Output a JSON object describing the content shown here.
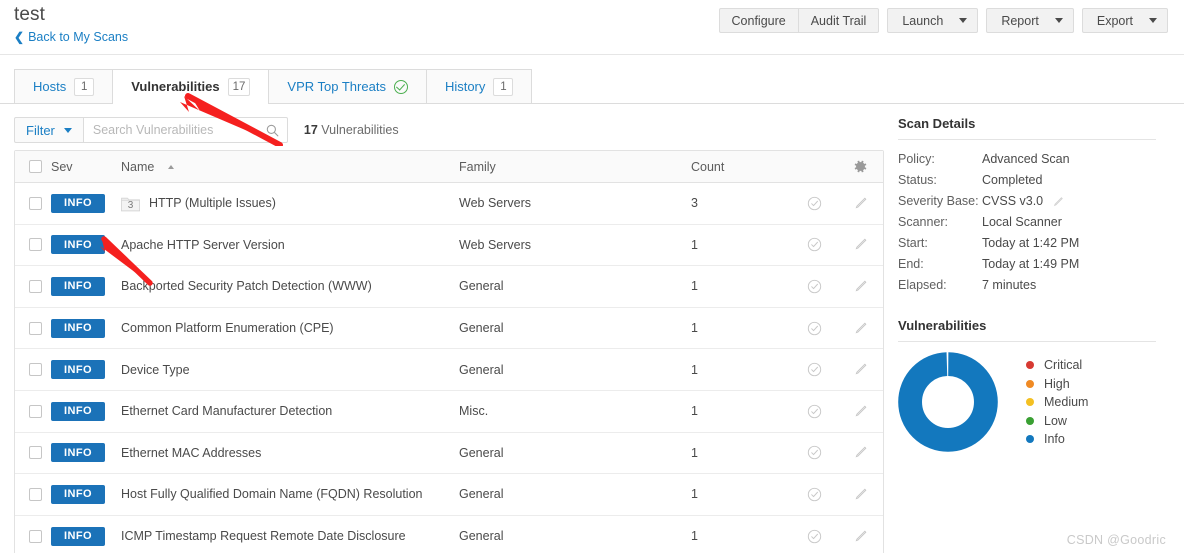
{
  "header": {
    "scan_title": "test",
    "back_link": "Back to My Scans",
    "back_icon": "chevron-left-icon",
    "actions": [
      {
        "label": "Configure",
        "type": "button"
      },
      {
        "label": "Audit Trail",
        "type": "button"
      },
      {
        "label": "Launch",
        "type": "split"
      },
      {
        "label": "Report",
        "type": "split"
      },
      {
        "label": "Export",
        "type": "split"
      }
    ]
  },
  "tabs": [
    {
      "label": "Hosts",
      "badge": "1",
      "active": false,
      "icon": ""
    },
    {
      "label": "Vulnerabilities",
      "badge": "17",
      "active": true,
      "icon": ""
    },
    {
      "label": "VPR Top Threats",
      "badge": "",
      "active": false,
      "icon": "check-circle-icon"
    },
    {
      "label": "History",
      "badge": "1",
      "active": false,
      "icon": ""
    }
  ],
  "toolbar": {
    "filter_label": "Filter",
    "search_placeholder": "Search Vulnerabilities",
    "search_value": "",
    "search_icon": "search-icon",
    "count_number": "17",
    "count_label": "Vulnerabilities"
  },
  "table": {
    "columns": {
      "sev": "Sev",
      "name": "Name",
      "family": "Family",
      "count": "Count",
      "settings_icon": "gear-icon"
    },
    "sort": {
      "column": "Name",
      "direction": "asc"
    },
    "rows": [
      {
        "severity": "INFO",
        "group_count": "3",
        "name": "HTTP (Multiple Issues)",
        "family": "Web Servers",
        "count": "3"
      },
      {
        "severity": "INFO",
        "group_count": "",
        "name": "Apache HTTP Server Version",
        "family": "Web Servers",
        "count": "1"
      },
      {
        "severity": "INFO",
        "group_count": "",
        "name": "Backported Security Patch Detection (WWW)",
        "family": "General",
        "count": "1"
      },
      {
        "severity": "INFO",
        "group_count": "",
        "name": "Common Platform Enumeration (CPE)",
        "family": "General",
        "count": "1"
      },
      {
        "severity": "INFO",
        "group_count": "",
        "name": "Device Type",
        "family": "General",
        "count": "1"
      },
      {
        "severity": "INFO",
        "group_count": "",
        "name": "Ethernet Card Manufacturer Detection",
        "family": "Misc.",
        "count": "1"
      },
      {
        "severity": "INFO",
        "group_count": "",
        "name": "Ethernet MAC Addresses",
        "family": "General",
        "count": "1"
      },
      {
        "severity": "INFO",
        "group_count": "",
        "name": "Host Fully Qualified Domain Name (FQDN) Resolution",
        "family": "General",
        "count": "1"
      },
      {
        "severity": "INFO",
        "group_count": "",
        "name": "ICMP Timestamp Request Remote Date Disclosure",
        "family": "General",
        "count": "1"
      }
    ]
  },
  "scan_details": {
    "title": "Scan Details",
    "rows": [
      {
        "label": "Policy:",
        "value": "Advanced Scan",
        "edit": false
      },
      {
        "label": "Status:",
        "value": "Completed",
        "edit": false
      },
      {
        "label": "Severity Base:",
        "value": "CVSS v3.0",
        "edit": true
      },
      {
        "label": "Scanner:",
        "value": "Local Scanner",
        "edit": false
      },
      {
        "label": "Start:",
        "value": "Today at 1:42 PM",
        "edit": false
      },
      {
        "label": "End:",
        "value": "Today at 1:49 PM",
        "edit": false
      },
      {
        "label": "Elapsed:",
        "value": "7 minutes",
        "edit": false
      }
    ]
  },
  "vulnerabilities_panel": {
    "title": "Vulnerabilities",
    "legend": [
      {
        "label": "Critical",
        "color": "#d73a32"
      },
      {
        "label": "High",
        "color": "#f08a24"
      },
      {
        "label": "Medium",
        "color": "#f4c022"
      },
      {
        "label": "Low",
        "color": "#3aa033"
      },
      {
        "label": "Info",
        "color": "#1378be"
      }
    ]
  },
  "chart_data": {
    "type": "pie",
    "title": "Vulnerabilities",
    "categories": [
      "Critical",
      "High",
      "Medium",
      "Low",
      "Info"
    ],
    "values": [
      0,
      0,
      0,
      0,
      17
    ],
    "colors": [
      "#d73a32",
      "#f08a24",
      "#f4c022",
      "#3aa033",
      "#1378be"
    ],
    "donut": true,
    "legend_position": "right"
  },
  "annotations": [
    {
      "type": "arrow",
      "color": "#f5201f",
      "target": "Vulnerabilities tab"
    },
    {
      "type": "arrow",
      "color": "#f5201f",
      "target": "INFO severity badge"
    }
  ],
  "watermark": {
    "text": "CSDN @Goodric"
  },
  "colors": {
    "accent_blue": "#1b7fc4",
    "badge_blue": "#1b72b8",
    "annotation_red": "#f5201f"
  }
}
